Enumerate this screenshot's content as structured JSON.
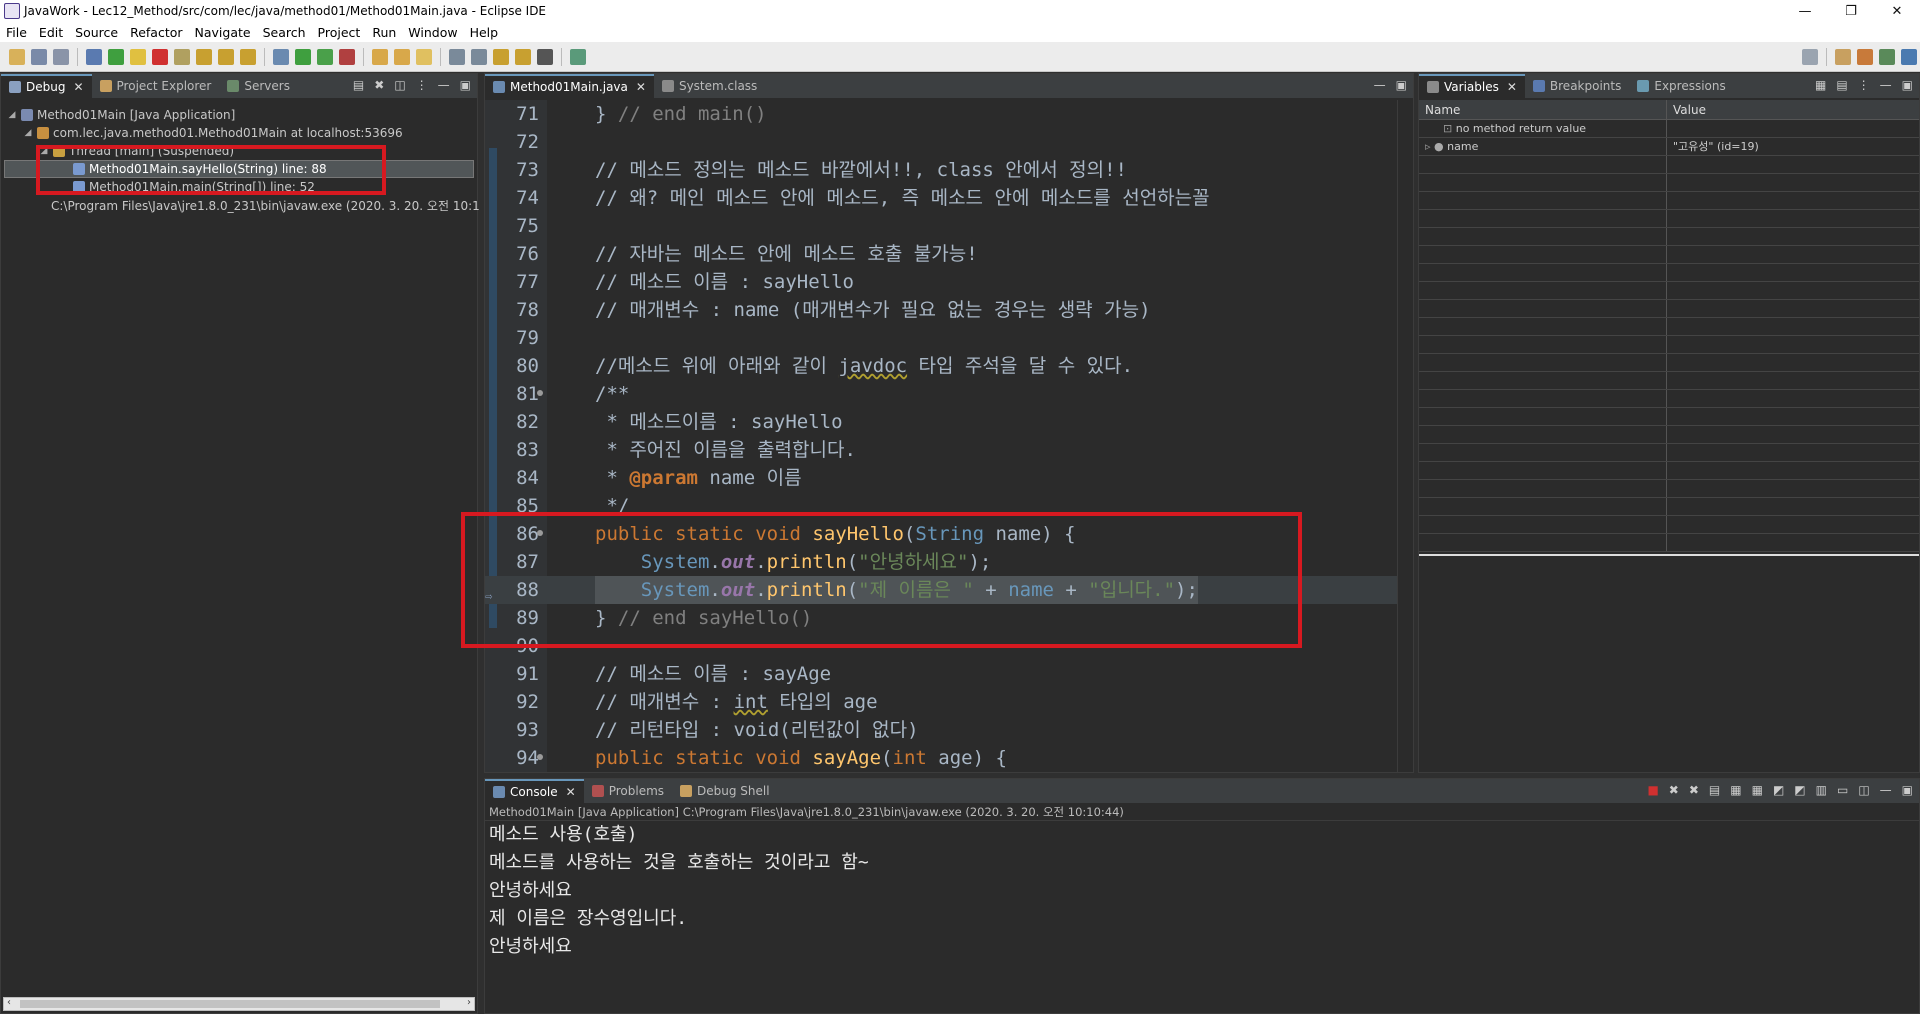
{
  "window": {
    "title": "JavaWork - Lec12_Method/src/com/lec/java/method01/Method01Main.java - Eclipse IDE",
    "buttons": {
      "minimize": "—",
      "maximize": "❐",
      "close": "✕"
    }
  },
  "menu": [
    "File",
    "Edit",
    "Source",
    "Refactor",
    "Navigate",
    "Search",
    "Project",
    "Run",
    "Window",
    "Help"
  ],
  "debug_panel": {
    "tabs": [
      "Debug",
      "Project Explorer",
      "Servers"
    ],
    "tree": [
      {
        "label": "Method01Main [Java Application]",
        "indent": 0
      },
      {
        "label": "com.lec.java.method01.Method01Main at localhost:53696",
        "indent": 1
      },
      {
        "label": "Thread [main] (Suspended)",
        "indent": 2
      },
      {
        "label": "Method01Main.sayHello(String) line: 88",
        "indent": 3,
        "selected": true
      },
      {
        "label": "Method01Main.main(String[]) line: 52",
        "indent": 3
      },
      {
        "label": "C:\\Program Files\\Java\\jre1.8.0_231\\bin\\javaw.exe (2020. 3. 20. 오전 10:1",
        "indent": 1
      }
    ]
  },
  "editor": {
    "tabs": [
      "Method01Main.java",
      "System.class"
    ],
    "lines": [
      {
        "n": "71",
        "t": "} // end main()"
      },
      {
        "n": "72",
        "t": ""
      },
      {
        "n": "73",
        "t": "// 메소드 정의는 메소드 바깥에서!!, class 안에서 정의!!"
      },
      {
        "n": "74",
        "t": "// 왜? 메인 메소드 안에 메소드, 즉 메소드 안에 메소드를 선언하는꼴"
      },
      {
        "n": "75",
        "t": ""
      },
      {
        "n": "76",
        "t": "// 자바는 메소드 안에 메소드 호출 불가능!"
      },
      {
        "n": "77",
        "t": "// 메소드 이름 : sayHello"
      },
      {
        "n": "78",
        "t": "// 매개변수 : name (매개변수가 필요 없는 경우는 생략 가능)"
      },
      {
        "n": "79",
        "t": ""
      },
      {
        "n": "80",
        "t": "//메소드 위에 아래와 같이 javdoc 타입 주석을 달 수 있다."
      },
      {
        "n": "81",
        "t": "/**"
      },
      {
        "n": "82",
        "t": " * 메소드이름 : sayHello"
      },
      {
        "n": "83",
        "t": " * 주어진 이름을 출력합니다."
      },
      {
        "n": "84",
        "t": " * @param name 이름"
      },
      {
        "n": "85",
        "t": " */"
      },
      {
        "n": "86",
        "t": "public static void sayHello(String name) {"
      },
      {
        "n": "87",
        "t": "    System.out.println(\"안녕하세요\");"
      },
      {
        "n": "88",
        "t": "    System.out.println(\"제 이름은 \" + name + \"입니다.\");"
      },
      {
        "n": "89",
        "t": "} // end sayHello()"
      },
      {
        "n": "90",
        "t": ""
      },
      {
        "n": "91",
        "t": "// 메소드 이름 : sayAge"
      },
      {
        "n": "92",
        "t": "// 매개변수 : int 타입의 age"
      },
      {
        "n": "93",
        "t": "// 리턴타입 : void(리턴값이 없다)"
      },
      {
        "n": "94",
        "t": "public static void sayAge(int age) {"
      }
    ]
  },
  "variables_panel": {
    "tabs": [
      "Variables",
      "Breakpoints",
      "Expressions"
    ],
    "columns": [
      "Name",
      "Value"
    ],
    "rows": [
      {
        "name": "no method return value",
        "value": ""
      },
      {
        "name": "name",
        "value": "\"고유성\" (id=19)"
      }
    ]
  },
  "console_panel": {
    "tabs": [
      "Console",
      "Problems",
      "Debug Shell"
    ],
    "header": "Method01Main [Java Application] C:\\Program Files\\Java\\jre1.8.0_231\\bin\\javaw.exe (2020. 3. 20. 오전 10:10:44)",
    "lines": [
      "메소드 사용(호출)",
      "메소드를 사용하는 것을 호출하는 것이라고 함~",
      "안녕하세요",
      "제 이름은 장수영입니다.",
      "안녕하세요"
    ]
  }
}
